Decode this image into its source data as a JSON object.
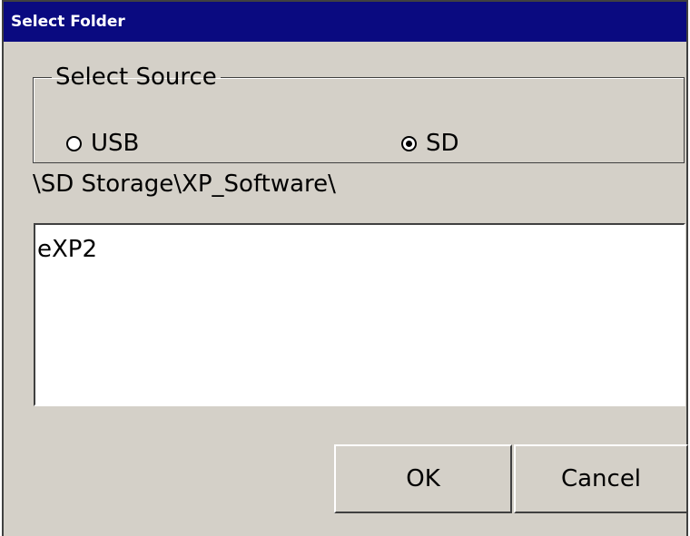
{
  "window": {
    "title": "Select Folder"
  },
  "source_group": {
    "legend": "Select Source",
    "options": [
      {
        "label": "USB",
        "selected": false
      },
      {
        "label": "SD",
        "selected": true
      }
    ]
  },
  "current_path": "\\SD Storage\\XP_Software\\",
  "folder_list": {
    "items": [
      "eXP2"
    ]
  },
  "buttons": {
    "ok_label": "OK",
    "cancel_label": "Cancel"
  },
  "colors": {
    "title_bar": "#0a0a80",
    "dialog_bg": "#d4d0c8"
  }
}
